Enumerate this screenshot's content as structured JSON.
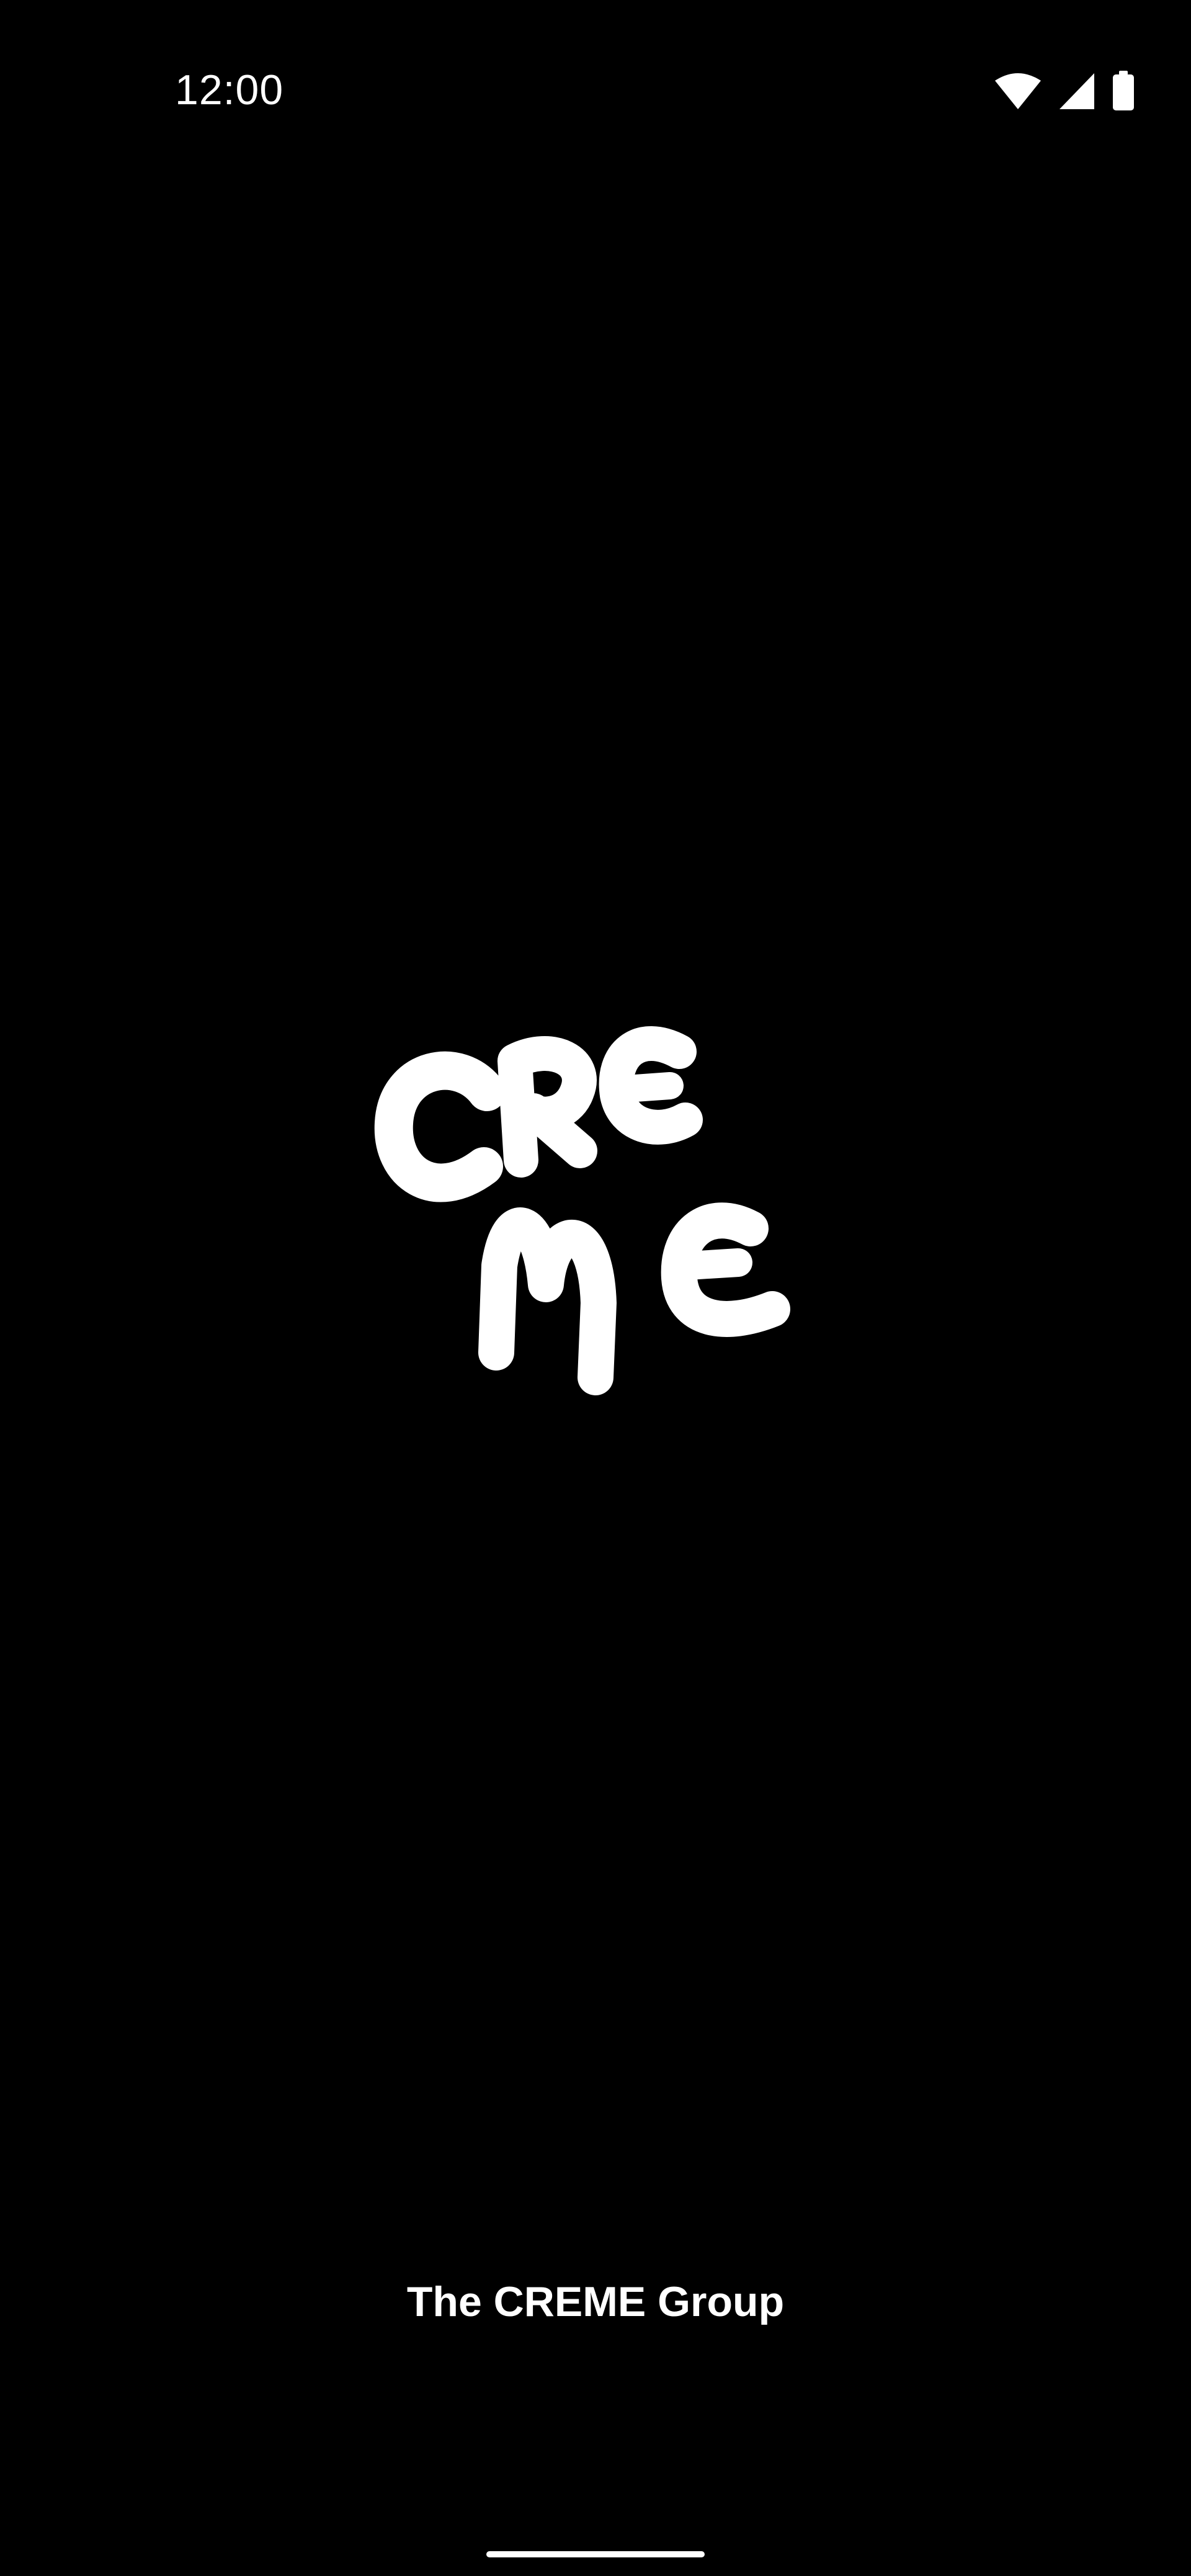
{
  "status_bar": {
    "time": "12:00",
    "icons": [
      "wifi-icon",
      "cellular-signal-icon",
      "battery-icon"
    ]
  },
  "splash": {
    "logo_text": "CREME",
    "footer_text": "The CREME Group"
  },
  "colors": {
    "background": "#000000",
    "foreground": "#ffffff"
  }
}
